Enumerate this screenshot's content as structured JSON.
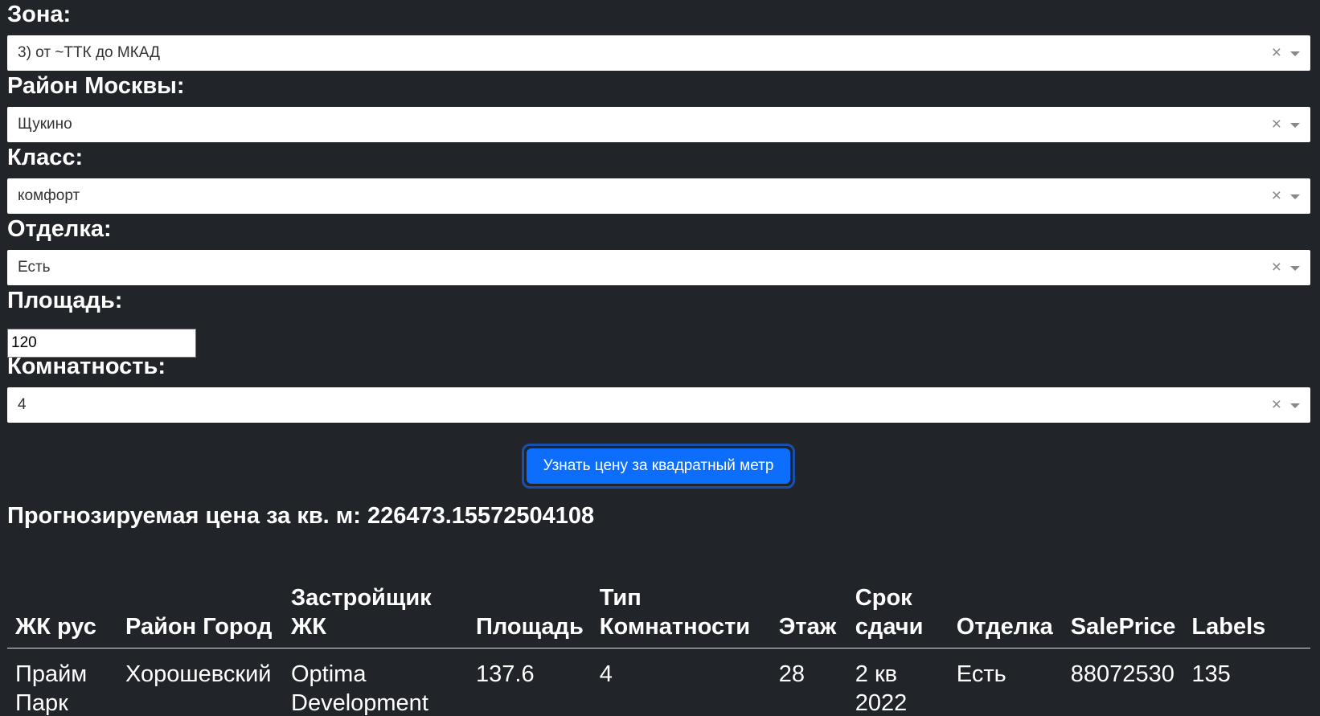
{
  "form": {
    "zone": {
      "label": "Зона:",
      "value": "3) от ~ТТК до МКАД"
    },
    "district": {
      "label": "Район Москвы:",
      "value": "Щукино"
    },
    "class": {
      "label": "Класс:",
      "value": "комфорт"
    },
    "finishing": {
      "label": "Отделка:",
      "value": "Есть"
    },
    "area": {
      "label": "Площадь:",
      "value": "120"
    },
    "rooms": {
      "label": "Комнатность:",
      "value": "4"
    },
    "clear_glyph": "×",
    "submit_label": "Узнать цену за квадратный метр"
  },
  "result": {
    "text": "Прогнозируемая цена за кв. м: 226473.15572504108"
  },
  "table": {
    "headers": [
      "ЖК рус",
      "Район Город",
      "Застройщик ЖК",
      "Площадь",
      "Тип Комнатности",
      "Этаж",
      "Срок сдачи",
      "Отделка",
      "SalePrice",
      "Labels"
    ],
    "rows": [
      [
        "Прайм Парк",
        "Хорошевский",
        "Optima Development",
        "137.6",
        "4",
        "28",
        "2 кв 2022",
        "Есть",
        "88072530",
        "135"
      ]
    ]
  },
  "colors": {
    "background": "#212529",
    "primary": "#0d6efd",
    "text": "#ffffff"
  },
  "icons": [
    "clear-icon",
    "chevron-down-icon"
  ]
}
